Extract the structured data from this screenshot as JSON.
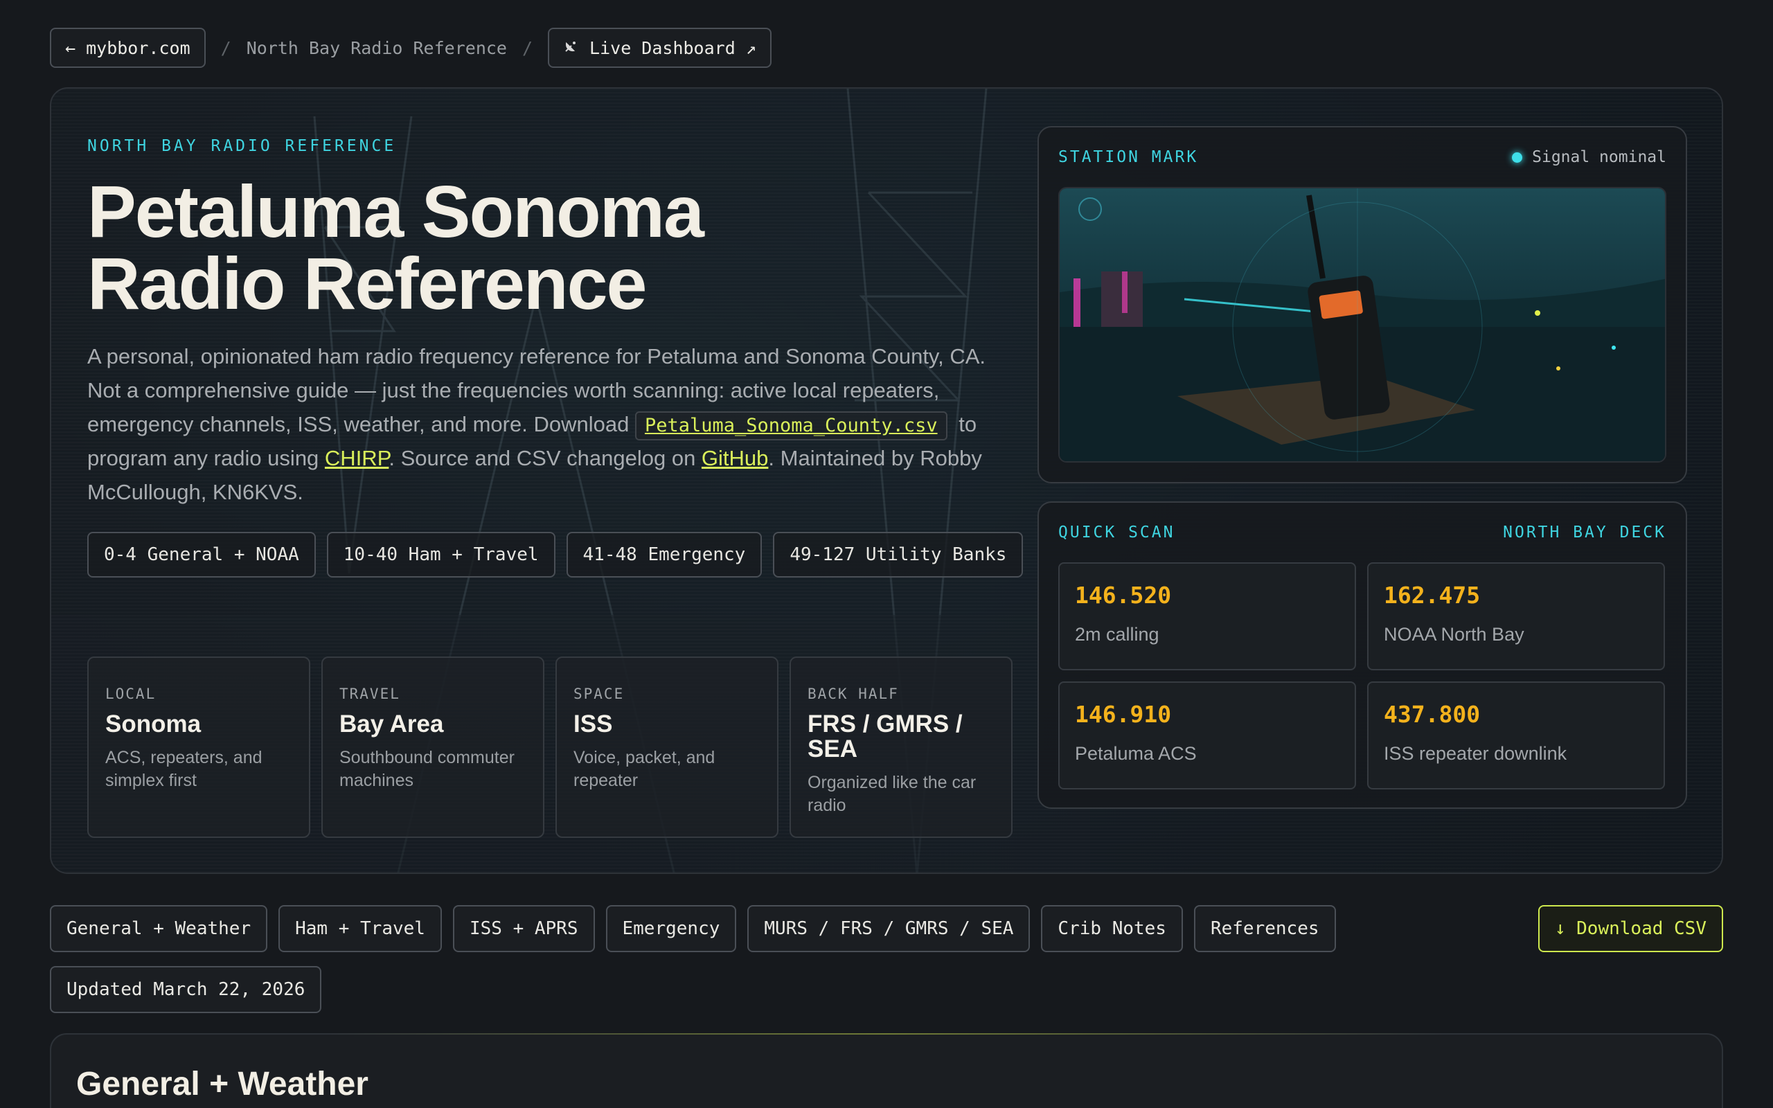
{
  "breadcrumb": {
    "back_label": "← mybbor.com",
    "separator": "/",
    "current": "North Bay Radio Reference",
    "dashboard_label": "Live Dashboard ↗",
    "dashboard_icon": "satellite-dish-icon"
  },
  "hero": {
    "eyebrow": "NORTH BAY RADIO REFERENCE",
    "title_line1": "Petaluma Sonoma",
    "title_line2": "Radio Reference",
    "desc_part1": "A personal, opinionated ham radio frequency reference for Petaluma and Sonoma County, CA. Not a comprehensive guide — just the frequencies worth scanning: active local repeaters, emergency channels, ISS, weather, and more. Download ",
    "csv_file": "Petaluma_Sonoma_County.csv",
    "desc_part2": " to program any radio using ",
    "chirp_link": "CHIRP",
    "desc_part3": ". Source and CSV changelog on ",
    "github_link": "GitHub",
    "desc_part4": ". Maintained by Robby McCullough, KN6KVS.",
    "bank_chips": [
      "0-4 General + NOAA",
      "10-40 Ham + Travel",
      "41-48 Emergency",
      "49-127 Utility Banks"
    ],
    "cards": [
      {
        "tag": "LOCAL",
        "title": "Sonoma",
        "sub": "ACS, repeaters, and simplex first"
      },
      {
        "tag": "TRAVEL",
        "title": "Bay Area",
        "sub": "Southbound commuter machines"
      },
      {
        "tag": "SPACE",
        "title": "ISS",
        "sub": "Voice, packet, and repeater"
      },
      {
        "tag": "BACK HALF",
        "title": "FRS / GMRS / SEA",
        "sub": "Organized like the car radio"
      }
    ]
  },
  "station": {
    "header": "STATION MARK",
    "status": "Signal nominal"
  },
  "quick_scan": {
    "header": "QUICK SCAN",
    "header_right": "NORTH BAY DECK",
    "items": [
      {
        "freq": "146.520",
        "label": "2m calling"
      },
      {
        "freq": "162.475",
        "label": "NOAA North Bay"
      },
      {
        "freq": "146.910",
        "label": "Petaluma ACS"
      },
      {
        "freq": "437.800",
        "label": "ISS repeater downlink"
      }
    ]
  },
  "section_nav": {
    "items": [
      "General + Weather",
      "Ham + Travel",
      "ISS + APRS",
      "Emergency",
      "MURS / FRS / GMRS / SEA",
      "Crib Notes",
      "References"
    ],
    "download_label": "↓ Download CSV",
    "updated": "Updated March 22, 2026"
  },
  "section": {
    "title": "General + Weather"
  },
  "colors": {
    "accent_cyan": "#3fd4e0",
    "accent_lime": "#d9ef5a",
    "freq_amber": "#f4b21c",
    "background": "#16191d"
  }
}
